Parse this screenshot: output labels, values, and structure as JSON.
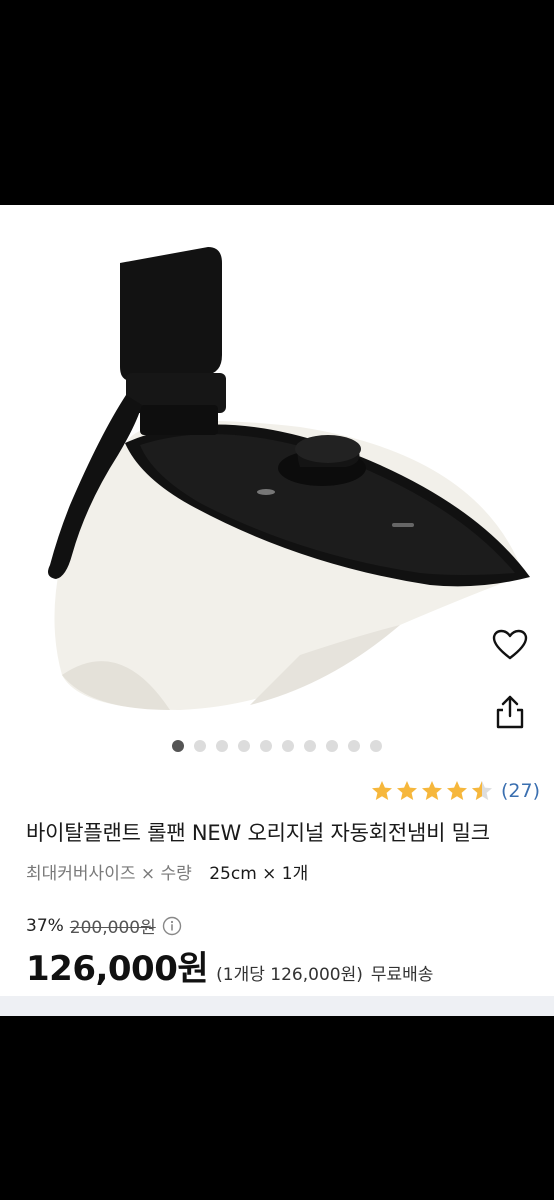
{
  "product": {
    "title": "바이탈플랜트 롤팬 NEW 오리지널 자동회전냄비 밀크",
    "image_alt": "automatic rotating pot product photo",
    "carousel": {
      "total": 10,
      "current": 1
    },
    "rating": {
      "stars": 4.5,
      "count_text": "(27)"
    },
    "option": {
      "label": "최대커버사이즈 × 수량",
      "value": "25cm × 1개"
    },
    "pricing": {
      "discount": "37%",
      "original_price": "200,000원",
      "price": "126,000원",
      "unit_price": "(1개당 126,000원)",
      "shipping": "무료배송"
    }
  },
  "colors": {
    "star": "#f6b73c",
    "star_empty": "#dddddd",
    "link": "#3a6fb0",
    "active_dot": "#555555"
  },
  "icons": {
    "wish": "heart-icon",
    "share": "share-icon",
    "info": "info-icon"
  }
}
